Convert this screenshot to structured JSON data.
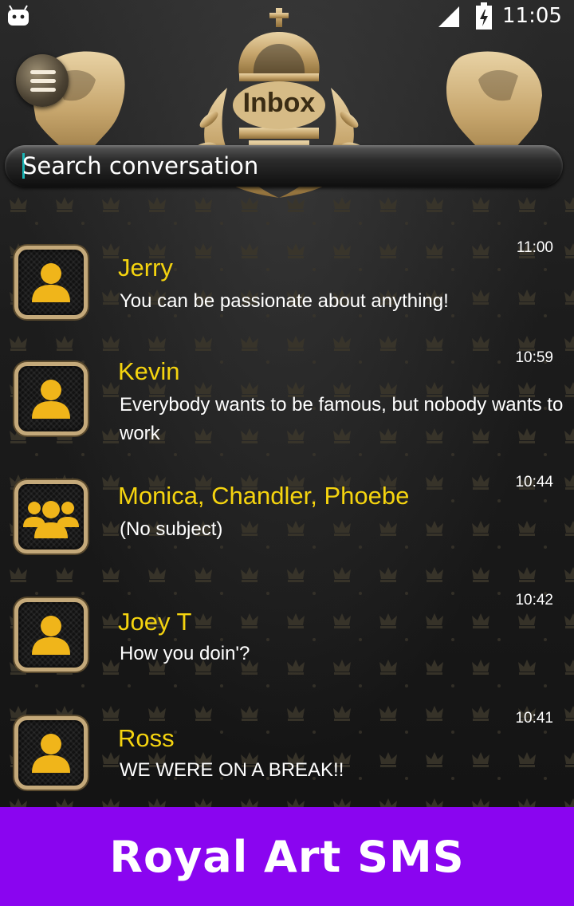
{
  "status_bar": {
    "time": "11:05"
  },
  "header": {
    "title": "Inbox"
  },
  "search": {
    "placeholder": "Search conversation"
  },
  "conversations": [
    {
      "name": "Jerry",
      "snippet": " You can be passionate about anything!",
      "time": "11:00",
      "avatar": "person-icon"
    },
    {
      "name": "Kevin",
      "snippet": " Everybody wants to be famous, but nobody wants to work",
      "time": "10:59",
      "avatar": "person-icon"
    },
    {
      "name": "Monica, Chandler, Phoebe",
      "snippet": "(No subject)",
      "time": "10:44",
      "avatar": "group-icon"
    },
    {
      "name": "Joey T",
      "snippet": "How you doin'?",
      "time": "10:42",
      "avatar": "person-icon"
    },
    {
      "name": "Ross",
      "snippet": "WE WERE ON A BREAK!!",
      "time": "10:41",
      "avatar": "person-icon"
    }
  ],
  "banner": {
    "text": "Royal Art SMS"
  },
  "colors": {
    "name": "#f5d40f",
    "gold": "#c4a97a",
    "banner": "#8a05f0"
  }
}
